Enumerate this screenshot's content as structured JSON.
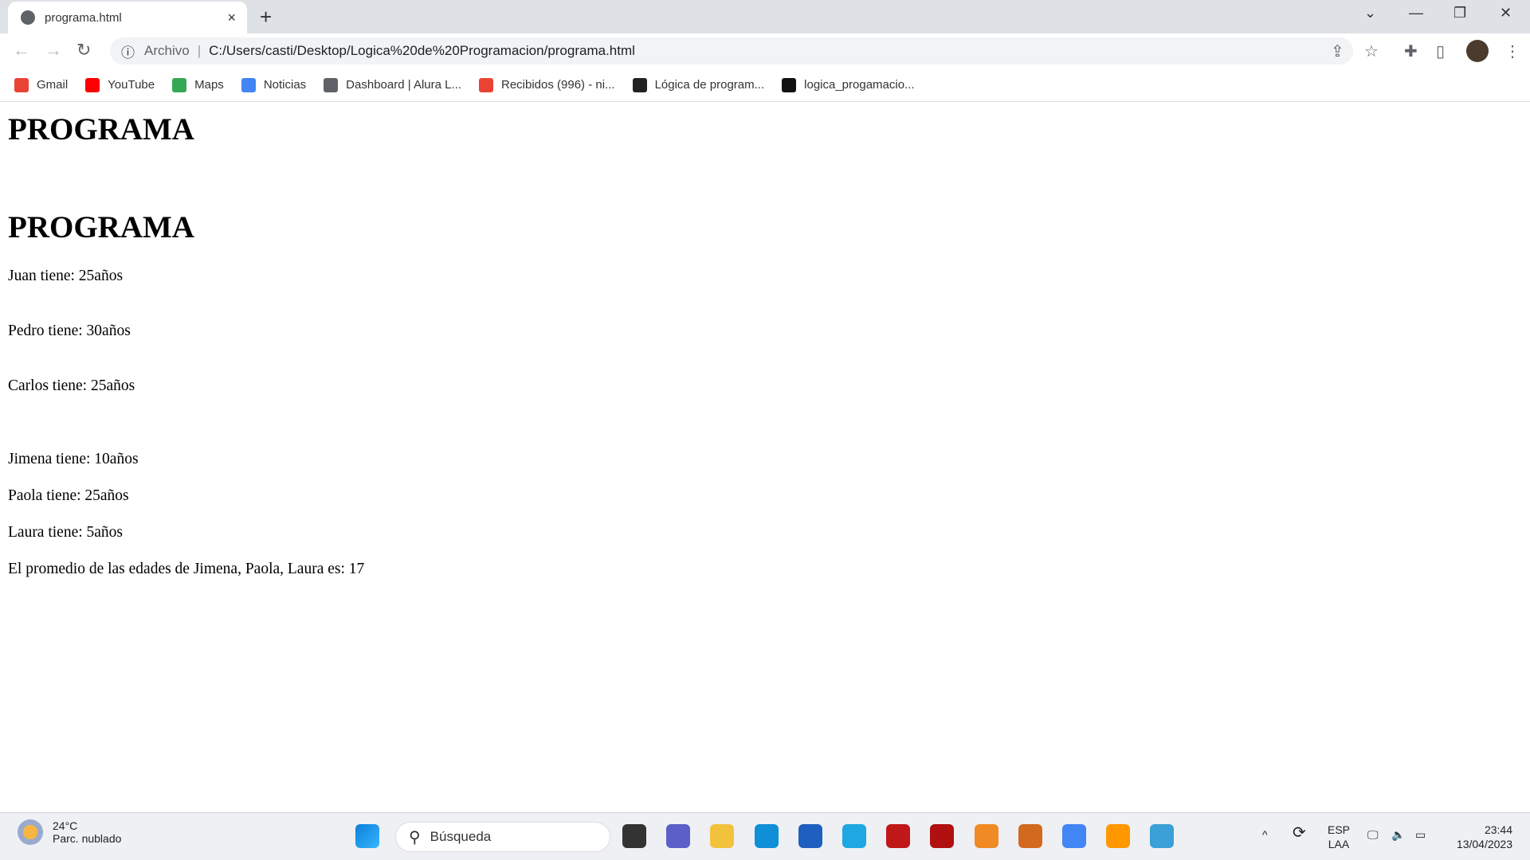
{
  "browser": {
    "tab_title": "programa.html",
    "tab_close": "×",
    "new_tab": "+",
    "address_prefix": "Archivo",
    "address_separator": "|",
    "url": "C:/Users/casti/Desktop/Logica%20de%20Programacion/programa.html",
    "bookmarks": [
      {
        "label": "Gmail",
        "color": "#ea4335"
      },
      {
        "label": "YouTube",
        "color": "#ff0000"
      },
      {
        "label": "Maps",
        "color": "#34a853"
      },
      {
        "label": "Noticias",
        "color": "#4285f4"
      },
      {
        "label": "Dashboard | Alura L...",
        "color": "#5f6368"
      },
      {
        "label": "Recibidos (996) - ni...",
        "color": "#ea4335"
      },
      {
        "label": "Lógica de program...",
        "color": "#222222"
      },
      {
        "label": "logica_progamacio...",
        "color": "#111111"
      }
    ]
  },
  "page": {
    "heading1": "PROGRAMA",
    "heading2": "PROGRAMA",
    "lines": [
      "Juan tiene: 25años",
      "Pedro tiene: 30años",
      "Carlos tiene: 25años",
      "Jimena tiene: 10años",
      "Paola tiene: 25años",
      "Laura tiene: 5años",
      "El promedio de las edades de Jimena, Paola, Laura es: 17"
    ]
  },
  "taskbar": {
    "temperature": "24°C",
    "weather": "Parc. nublado",
    "search_placeholder": "Búsqueda",
    "lang_top": "ESP",
    "lang_bottom": "LAA",
    "time": "23:44",
    "date": "13/04/2023",
    "apps": [
      {
        "name": "task-view",
        "color": "#333333"
      },
      {
        "name": "chat",
        "color": "#5b5fc7"
      },
      {
        "name": "file-explorer",
        "color": "#f3c23c"
      },
      {
        "name": "edge",
        "color": "#0f8fd8"
      },
      {
        "name": "store",
        "color": "#1f5fbf"
      },
      {
        "name": "l-app",
        "color": "#1ea7e1"
      },
      {
        "name": "mcafee",
        "color": "#c01818"
      },
      {
        "name": "red-app",
        "color": "#b01010"
      },
      {
        "name": "media-player",
        "color": "#f08a24"
      },
      {
        "name": "game-app",
        "color": "#d2691e"
      },
      {
        "name": "chrome",
        "color": "#4285f4"
      },
      {
        "name": "sublime-text",
        "color": "#ff9800"
      },
      {
        "name": "globe-app",
        "color": "#3aa0d8"
      }
    ]
  }
}
